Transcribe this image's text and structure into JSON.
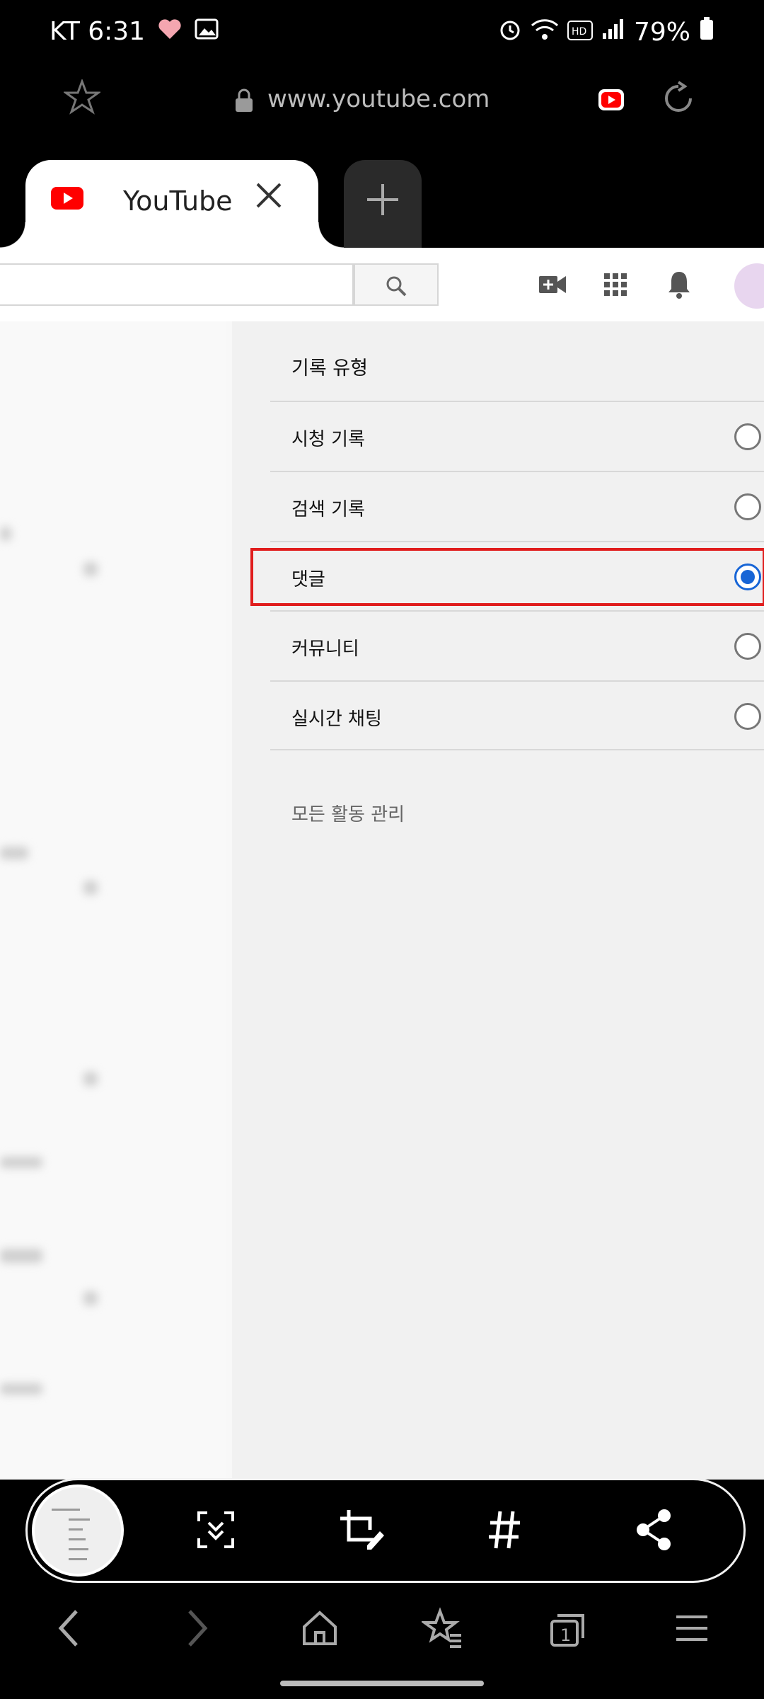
{
  "status": {
    "carrier_time": "KT 6:31",
    "battery": "79%"
  },
  "browser": {
    "url": "www.youtube.com",
    "tab_title": "YouTube"
  },
  "panel": {
    "title": "기록 유형",
    "options": [
      {
        "label": "시청 기록",
        "selected": false
      },
      {
        "label": "검색 기록",
        "selected": false
      },
      {
        "label": "댓글",
        "selected": true
      },
      {
        "label": "커뮤니티",
        "selected": false
      },
      {
        "label": "실시간 채팅",
        "selected": false
      }
    ],
    "manage_link": "모든 활동 관리"
  },
  "colors": {
    "youtube_red": "#ff0000",
    "highlight_red": "#e01d1d",
    "radio_blue": "#1765d6"
  },
  "icons": {
    "status": [
      "heart-icon",
      "image-icon",
      "alarm-icon",
      "wifi-icon",
      "hd-icon",
      "signal-icon",
      "battery-icon"
    ],
    "capture_toolbar": [
      "scroll-capture-icon",
      "crop-edit-icon",
      "hashtag-icon",
      "share-icon"
    ],
    "bottom_nav": [
      "back-icon",
      "forward-icon",
      "home-icon",
      "bookmarks-icon",
      "tabs-icon",
      "menu-icon"
    ]
  },
  "tabs_count": "1"
}
